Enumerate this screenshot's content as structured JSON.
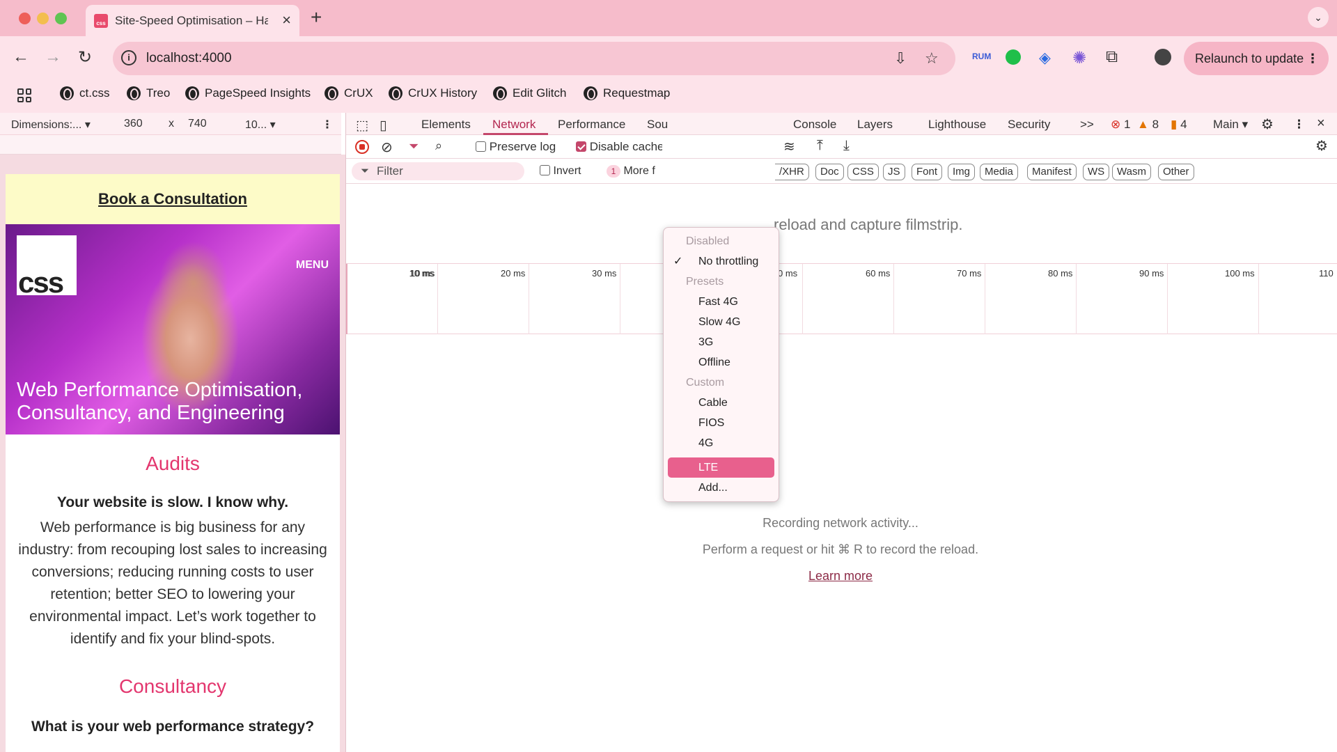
{
  "browser": {
    "tab_title": "Site-Speed Optimisation – Ha",
    "url": "localhost:4000",
    "relaunch_label": "Relaunch to update",
    "bookmarks": [
      "ct.css",
      "Treo",
      "PageSpeed Insights",
      "CrUX",
      "CrUX History",
      "Edit Glitch",
      "Requestmap"
    ]
  },
  "device_toolbar": {
    "dimensions": "Dimensions:...",
    "width": "360",
    "times": "x",
    "height": "740",
    "zoom": "10..."
  },
  "page": {
    "book_label": "Book a Consultation",
    "logo_text": "css",
    "menu_label": "MENU",
    "hero_title": "Web Performance Optimisation, Consultancy, and Engineering",
    "audits_heading": "Audits",
    "audits_lead": "Your website is slow. I know why.",
    "audits_body": "Web performance is big business for any industry: from recouping lost sales to increasing conversions; reducing running costs to user retention; better SEO to lowering your environmental impact. Let’s work together to identify and fix your blind-spots.",
    "consultancy_heading": "Consultancy",
    "consultancy_lead": "What is your web performance strategy?"
  },
  "devtools": {
    "tabs": [
      "Elements",
      "Network",
      "Performance",
      "Sou",
      "Console",
      "Layers",
      "Lighthouse",
      "Security"
    ],
    "active_tab": "Network",
    "more_tabs": ">>",
    "errors": "1",
    "warnings": "8",
    "issues": "4",
    "context": "Main",
    "preserve_log": "Preserve log",
    "disable_cache": "Disable cache",
    "filter_placeholder": "Filter",
    "invert": "Invert",
    "more_filters_count": "1",
    "more_filters": "More f",
    "type_filters": [
      "/XHR",
      "Doc",
      "CSS",
      "JS",
      "Font",
      "Img",
      "Media",
      "Manifest",
      "WS",
      "Wasm",
      "Other"
    ],
    "filmstrip_hint": "reload and capture filmstrip.",
    "timeline_ticks": [
      "10 ms",
      "20 ms",
      "30 ms",
      "0 ms",
      "60 ms",
      "70 ms",
      "80 ms",
      "90 ms",
      "100 ms",
      "110"
    ],
    "empty_line1": "Recording network activity...",
    "empty_line2": "Perform a request or hit ⌘ R to record the reload.",
    "learn_more": "Learn more"
  },
  "throttle_menu": {
    "disabled_header": "Disabled",
    "no_throttling": "No throttling",
    "presets_header": "Presets",
    "presets": [
      "Fast 4G",
      "Slow 4G",
      "3G",
      "Offline"
    ],
    "custom_header": "Custom",
    "custom": [
      "Cable",
      "FIOS",
      "4G",
      "LTE"
    ],
    "selected": "LTE",
    "add": "Add..."
  },
  "colors": {
    "chrome_pink": "#f6bccb",
    "accent": "#e3366e",
    "menu_highlight": "#e8608d"
  }
}
